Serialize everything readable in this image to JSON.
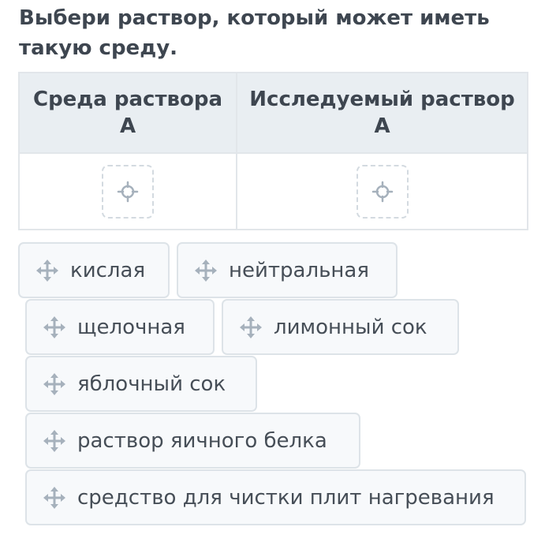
{
  "question": "Выбери раствор, который может иметь такую среду.",
  "table": {
    "headers": [
      "Среда раствора А",
      "Исследуемый раствор А"
    ]
  },
  "options": [
    {
      "label": "кислая",
      "icon": "move-icon"
    },
    {
      "label": "нейтральная",
      "icon": "move-icon"
    },
    {
      "label": "щелочная",
      "icon": "move-icon"
    },
    {
      "label": "лимонный сок",
      "icon": "move-icon"
    },
    {
      "label": "яблочный сок",
      "icon": "move-icon"
    },
    {
      "label": "раствор яичного белка",
      "icon": "move-icon"
    },
    {
      "label": "средство для чистки плит нагревания",
      "icon": "move-icon"
    }
  ],
  "colors": {
    "text": "#3e4650",
    "icon": "#a6b1bc",
    "header_bg": "#e9eef2",
    "border": "#e2e6ea",
    "chip_bg": "#f7f9fb"
  }
}
